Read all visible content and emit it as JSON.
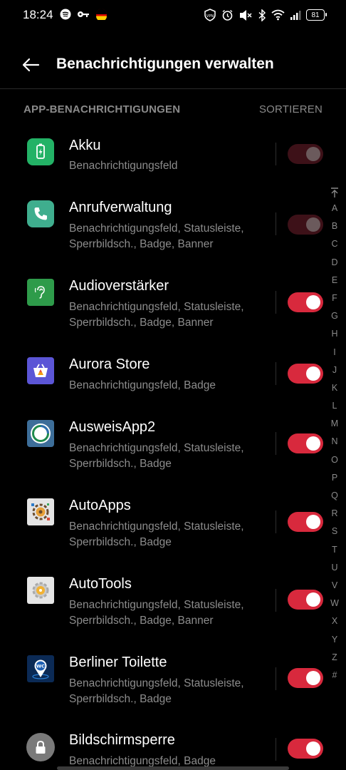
{
  "status_bar": {
    "time": "18:24",
    "left_icons": [
      "spotify-icon",
      "key-icon",
      "germany-flag-icon"
    ],
    "right_icons": [
      "vpn-icon",
      "alarm-icon",
      "mute-icon",
      "bluetooth-icon",
      "wifi-icon",
      "signal-icon"
    ],
    "vpn_label": "VPN",
    "battery": "81"
  },
  "header": {
    "title": "Benachrichtigungen verwalten"
  },
  "section": {
    "title": "APP-BENACHRICHTIGUNGEN",
    "sort_label": "SORTIEREN"
  },
  "apps": [
    {
      "name": "Akku",
      "sub1": "Benachrichtigungsfeld",
      "sub2": "",
      "enabled": true,
      "disabled": true,
      "icon": "battery-charging-icon"
    },
    {
      "name": "Anrufverwaltung",
      "sub1": "Benachrichtigungsfeld, Statusleiste,",
      "sub2": "Sperrbildsch., Badge, Banner",
      "enabled": true,
      "disabled": true,
      "icon": "phone-icon"
    },
    {
      "name": "Audioverstärker",
      "sub1": "Benachrichtigungsfeld, Statusleiste,",
      "sub2": "Sperrbildsch., Badge, Banner",
      "enabled": true,
      "disabled": false,
      "icon": "hearing-icon"
    },
    {
      "name": "Aurora Store",
      "sub1": "Benachrichtigungsfeld, Badge",
      "sub2": "",
      "enabled": true,
      "disabled": false,
      "icon": "store-bag-icon"
    },
    {
      "name": "AusweisApp2",
      "sub1": "Benachrichtigungsfeld, Statusleiste,",
      "sub2": "Sperrbildsch., Badge",
      "enabled": true,
      "disabled": false,
      "icon": "ausweis-icon"
    },
    {
      "name": "AutoApps",
      "sub1": "Benachrichtigungsfeld, Statusleiste,",
      "sub2": "Sperrbildsch., Badge",
      "enabled": true,
      "disabled": false,
      "icon": "autoapps-gear-icon"
    },
    {
      "name": "AutoTools",
      "sub1": "Benachrichtigungsfeld, Statusleiste,",
      "sub2": "Sperrbildsch., Badge, Banner",
      "enabled": true,
      "disabled": false,
      "icon": "autotools-gear-icon"
    },
    {
      "name": "Berliner Toilette",
      "sub1": "Benachrichtigungsfeld, Statusleiste,",
      "sub2": "Sperrbildsch., Badge",
      "enabled": true,
      "disabled": false,
      "icon": "wc-pin-icon",
      "icon_text": "WC"
    },
    {
      "name": "Bildschirmsperre",
      "sub1": "Benachrichtigungsfeld, Badge",
      "sub2": "",
      "enabled": true,
      "disabled": false,
      "icon": "lock-icon"
    }
  ],
  "alpha_index": [
    "A",
    "B",
    "C",
    "D",
    "E",
    "F",
    "G",
    "H",
    "I",
    "J",
    "K",
    "L",
    "M",
    "N",
    "O",
    "P",
    "Q",
    "R",
    "S",
    "T",
    "U",
    "V",
    "W",
    "X",
    "Y",
    "Z",
    "#"
  ],
  "colors": {
    "accent": "#d8293d",
    "accent_disabled": "#3d1118",
    "background": "#000000",
    "secondary_text": "#8c8c8c"
  }
}
